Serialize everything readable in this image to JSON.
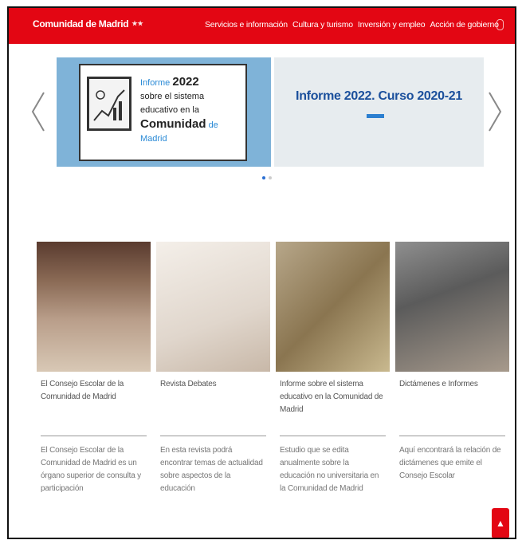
{
  "brand": {
    "name": "Comunidad de Madrid"
  },
  "nav": [
    "Servicios e información",
    "Cultura y turismo",
    "Inversión y empleo",
    "Acción de gobierno"
  ],
  "carousel": {
    "slide1": {
      "line1a": "Informe",
      "line1b": "2022",
      "line2": "sobre el sistema",
      "line3": "educativo en la",
      "line4a": "Comunidad",
      "line4b": "de Madrid"
    },
    "slide2": {
      "title": "Informe 2022. Curso 2020-21"
    },
    "dots": 2,
    "active_dot": 0
  },
  "cards": [
    {
      "title": "El Consejo Escolar de la Comunidad de Madrid",
      "desc": "El Consejo Escolar de la Comunidad de Madrid es un órgano superior de consulta y participación"
    },
    {
      "title": "Revista Debates",
      "desc": "En esta revista podrá encontrar temas de actualidad sobre aspectos de la educación"
    },
    {
      "title": "Informe sobre el sistema educativo en la Comunidad de Madrid",
      "desc": "Estudio que se edita anualmente sobre la educación no universitaria en la Comunidad de Madrid"
    },
    {
      "title": "Dictámenes e Informes",
      "desc": "Aquí encontrará la relación de dictámenes que emite el Consejo Escolar"
    }
  ],
  "colors": {
    "brand_red": "#e30613",
    "accent_blue": "#2a6fd2"
  }
}
